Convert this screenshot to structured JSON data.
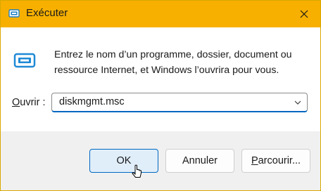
{
  "window": {
    "title": "Exécuter",
    "accent_color": "#f7b000"
  },
  "dialog": {
    "description": "Entrez le nom d’un programme, dossier, document ou ressource Internet, et Windows l’ouvrira pour vous.",
    "open_label_prefix": "",
    "open_label_mnemonic": "O",
    "open_label_rest": "uvrir :",
    "combo_value": "diskmgmt.msc"
  },
  "buttons": {
    "ok": "OK",
    "cancel": "Annuler",
    "browse_mnemonic": "P",
    "browse_rest": "arcourir..."
  },
  "icons": {
    "app": "run-dialog-icon",
    "close": "close-icon",
    "dropdown": "chevron-down-icon"
  }
}
